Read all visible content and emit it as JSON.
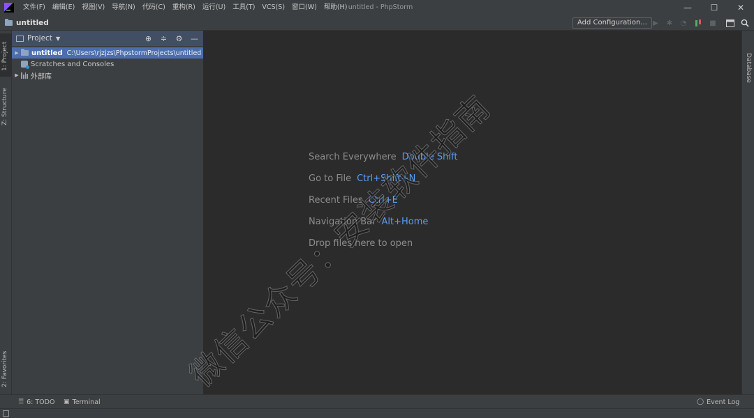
{
  "menu": {
    "items": [
      "文件(F)",
      "编辑(E)",
      "视图(V)",
      "导航(N)",
      "代码(C)",
      "重构(R)",
      "运行(U)",
      "工具(T)",
      "VCS(S)",
      "窗口(W)",
      "帮助(H)"
    ]
  },
  "window": {
    "title": "untitled - PhpStorm",
    "controls": {
      "minimize": "—",
      "maximize": "☐",
      "close": "✕"
    }
  },
  "navbar": {
    "breadcrumb": "untitled",
    "run_config": "Add Configuration..."
  },
  "left_stripe": {
    "project_tab": "1: Project",
    "structure_tab": "Z: Structure",
    "favorites_tab": "2: Favorites"
  },
  "right_stripe": {
    "database_tab": "Database"
  },
  "project_panel": {
    "title": "Project",
    "tree": [
      {
        "name": "untitled",
        "path": "C:\\Users\\rjzjzs\\PhpstormProjects\\untitled"
      },
      {
        "name": "Scratches and Consoles"
      },
      {
        "name": "外部库"
      }
    ]
  },
  "editor": {
    "hints": [
      {
        "label": "Search Everywhere",
        "shortcut": "Double Shift"
      },
      {
        "label": "Go to File",
        "shortcut": "Ctrl+Shift+N"
      },
      {
        "label": "Recent Files",
        "shortcut": "Ctrl+E"
      },
      {
        "label": "Navigation Bar",
        "shortcut": "Alt+Home"
      },
      {
        "label": "Drop files here to open",
        "shortcut": ""
      }
    ]
  },
  "watermark": "微信公众号：安装软件指南",
  "bottom_bar": {
    "todo": "6: TODO",
    "terminal": "Terminal",
    "event_log": "Event Log"
  },
  "colors": {
    "background": "#2b2b2b",
    "panel": "#3c3f41",
    "selection": "#4b6eaf",
    "shortcut": "#589df6"
  }
}
